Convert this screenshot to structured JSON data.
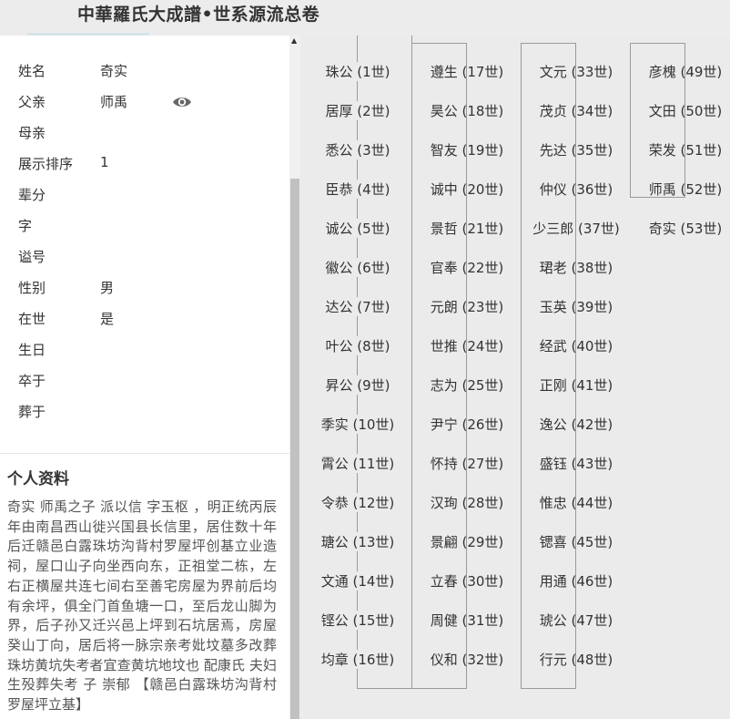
{
  "header": {
    "title": "中華羅氏大成譜•世系源流总卷"
  },
  "person": {
    "fields": [
      {
        "key": "姓名",
        "value": "奇实"
      },
      {
        "key": "父亲",
        "value": "师禹"
      },
      {
        "key": "母亲",
        "value": ""
      },
      {
        "key": "展示排序",
        "value": "1"
      },
      {
        "key": "辈分",
        "value": ""
      },
      {
        "key": "字",
        "value": ""
      },
      {
        "key": "谥号",
        "value": ""
      },
      {
        "key": "性别",
        "value": "男"
      },
      {
        "key": "在世",
        "value": "是"
      },
      {
        "key": "生日",
        "value": ""
      },
      {
        "key": "卒于",
        "value": ""
      },
      {
        "key": "葬于",
        "value": ""
      }
    ],
    "father_view_icon": "eye-icon"
  },
  "profile": {
    "title": "个人资料",
    "text": "奇实 师禹之子 派以信 字玉枢 ，明正统丙辰年由南昌西山徙兴国县长信里，居住数十年后迁赣邑白露珠坊沟背村罗屋坪创基立业造祠，屋口山子向坐西向东，正祖堂二栋，左右正横屋共连七间右至善宅房屋为界前后均有余坪，俱全门首鱼塘一口，至后龙山脚为界，后子孙又迁兴邑上坪到石坑居焉，房屋癸山丁向，居后将一脉宗亲考妣坟墓多改葬珠坊黄坑失考者宜查黄坑地坟也 配康氏 夫妇生殁葬失考 子 崇郁 【赣邑白露珠坊沟背村罗屋坪立基】"
  },
  "lineage": {
    "columns": [
      [
        "珠公 (1世)",
        "居厚 (2世)",
        "悉公 (3世)",
        "臣恭 (4世)",
        "诚公 (5世)",
        "徽公 (6世)",
        "达公 (7世)",
        "叶公 (8世)",
        "昇公 (9世)",
        "季实 (10世)",
        "霄公 (11世)",
        "令恭 (12世)",
        "瑭公 (13世)",
        "文通 (14世)",
        "铿公 (15世)",
        "均章 (16世)"
      ],
      [
        "遵生 (17世)",
        "昊公 (18世)",
        "智友 (19世)",
        "诚中 (20世)",
        "景哲 (21世)",
        "官奉 (22世)",
        "元朗 (23世)",
        "世推 (24世)",
        "志为 (25世)",
        "尹宁 (26世)",
        "怀持 (27世)",
        "汉珣 (28世)",
        "景翩 (29世)",
        "立春 (30世)",
        "周健 (31世)",
        "仪和 (32世)"
      ],
      [
        "文元 (33世)",
        "茂贞 (34世)",
        "先达 (35世)",
        "仲仪 (36世)",
        "少三郎 (37世)",
        "珺老 (38世)",
        "玉英 (39世)",
        "经武 (40世)",
        "正刚 (41世)",
        "逸公 (42世)",
        "盛钰 (43世)",
        "惟忠 (44世)",
        "锶喜 (45世)",
        "用通 (46世)",
        "琥公 (47世)",
        "行元 (48世)"
      ],
      [
        "彦槐 (49世)",
        "文田 (50世)",
        "荣发 (51世)",
        "师禹 (52世)",
        "奇实 (53世)"
      ]
    ]
  }
}
